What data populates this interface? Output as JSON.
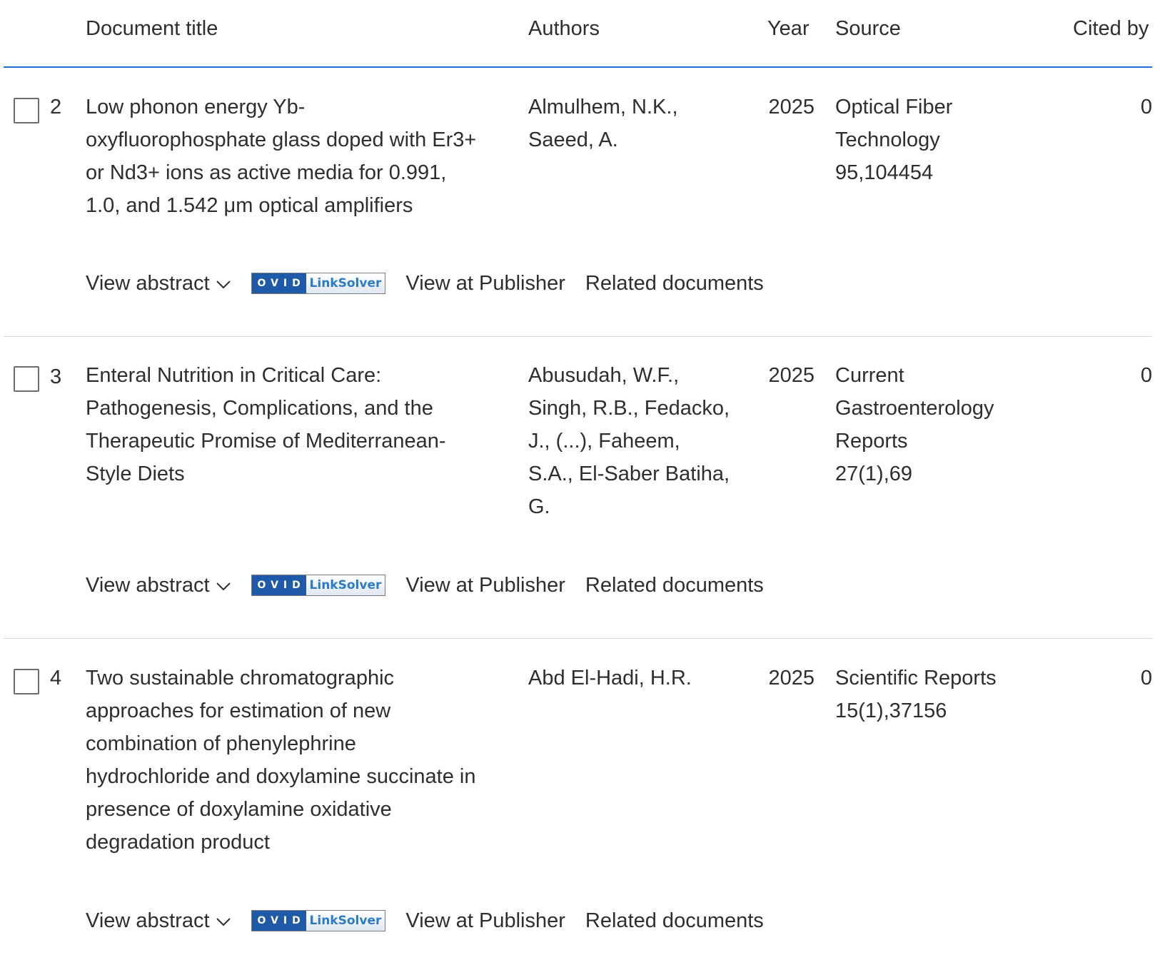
{
  "header": {
    "document_title": "Document title",
    "authors": "Authors",
    "year": "Year",
    "source": "Source",
    "cited_by": "Cited by"
  },
  "actions": {
    "view_abstract": "View abstract",
    "ovid_label": "OVID",
    "linksolver_label": "LinkSolver",
    "view_at_publisher": "View at Publisher",
    "related_documents": "Related documents"
  },
  "rows": [
    {
      "num": "2",
      "title_lines": [
        "Low phonon energy Yb-",
        "oxyfluorophosphate glass doped with Er3+",
        "or Nd3+ ions as active media for 0.991,",
        "1.0, and 1.542 μm optical amplifiers"
      ],
      "author_lines": [
        "Almulhem, N.K.,",
        "Saeed, A."
      ],
      "year": "2025",
      "source_lines": [
        "Optical Fiber",
        "Technology",
        "95,104454"
      ],
      "cited_by": "0"
    },
    {
      "num": "3",
      "title_lines": [
        "Enteral Nutrition in Critical Care:",
        "Pathogenesis, Complications, and the",
        "Therapeutic Promise of Mediterranean-",
        "Style Diets"
      ],
      "author_lines": [
        "Abusudah, W.F.,",
        "Singh, R.B., Fedacko,",
        "J., (...), Faheem,",
        "S.A., El-Saber Batiha,",
        "G."
      ],
      "year": "2025",
      "source_lines": [
        "Current",
        "Gastroenterology",
        "Reports",
        "27(1),69"
      ],
      "cited_by": "0"
    },
    {
      "num": "4",
      "title_lines": [
        "Two sustainable chromatographic",
        "approaches for estimation of new",
        "combination of phenylephrine",
        "hydrochloride and doxylamine succinate in",
        "presence of doxylamine oxidative",
        "degradation product"
      ],
      "author_lines": [
        "Abd El-Hadi, H.R."
      ],
      "year": "2025",
      "source_lines": [
        "Scientific Reports",
        "15(1),37156"
      ],
      "cited_by": "0"
    }
  ]
}
